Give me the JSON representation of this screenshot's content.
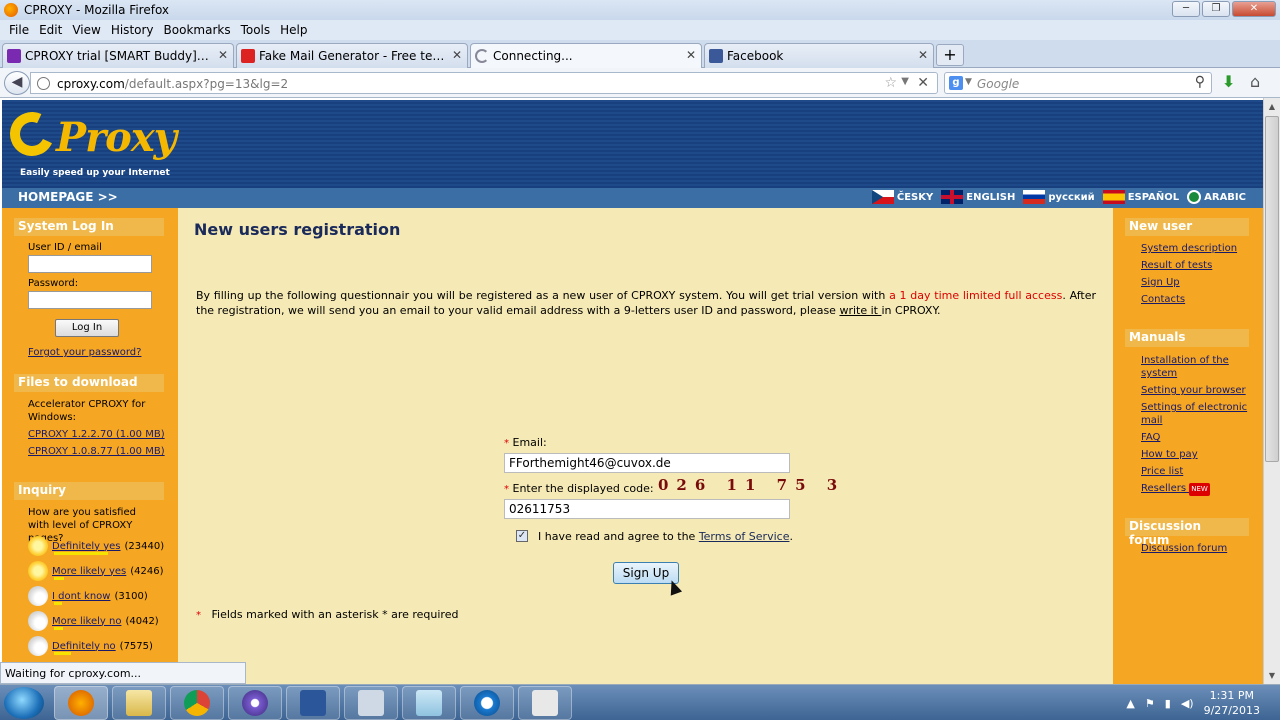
{
  "window": {
    "title": "CPROXY - Mozilla Firefox"
  },
  "menu": [
    "File",
    "Edit",
    "View",
    "History",
    "Bookmarks",
    "Tools",
    "Help"
  ],
  "tabs": [
    {
      "label": "CPROXY trial [SMART Buddy] with D...",
      "icon": "cproxy-icon"
    },
    {
      "label": "Fake Mail Generator - Free temporary...",
      "icon": "fakemail-icon"
    },
    {
      "label": "Connecting...",
      "icon": "loading-icon"
    },
    {
      "label": "Facebook",
      "icon": "facebook-icon"
    }
  ],
  "nav": {
    "url_host": "cproxy.com",
    "url_path": "/default.aspx?pg=13&lg=2",
    "search_placeholder": "Google"
  },
  "header": {
    "logo": "Proxy",
    "tagline": "Easily speed up your Internet",
    "homepage": "HOMEPAGE >>",
    "langs": [
      "ČESKY",
      "ENGLISH",
      "русский",
      "ESPAÑOL",
      "ARABIC"
    ]
  },
  "left": {
    "login_head": "System Log In",
    "user_label": "User ID / email",
    "pass_label": "Password:",
    "login_btn": "Log In",
    "forgot": "Forgot your password?",
    "files_head": "Files to download",
    "files_text": "Accelerator CPROXY for Windows:",
    "file1": "CPROXY 1.2.2.70 (1.00 MB)",
    "file2": "CPROXY 1.0.8.77 (1.00 MB)",
    "inquiry_head": "Inquiry",
    "inquiry_text": "How are you satisfied with level of CPROXY pages?",
    "votes": [
      {
        "label": "Definitely yes",
        "count": "(23440)",
        "share": 1.0
      },
      {
        "label": "More likely yes",
        "count": "(4246)",
        "share": 0.18
      },
      {
        "label": "I dont know",
        "count": "(3100)",
        "share": 0.13
      },
      {
        "label": "More likely no",
        "count": "(4042)",
        "share": 0.17
      },
      {
        "label": "Definitely no",
        "count": "(7575)",
        "share": 0.32
      }
    ]
  },
  "main": {
    "title": "New users registration",
    "para1": "By filling up the following questionnair you will be registered as a new user of CPROXY system. You will get trial version with ",
    "para_red": "a 1 day time limited full access",
    "para2": ". After the registration, we will send you an email to your valid email address with a 9-letters user ID and password, please ",
    "para_link": "write it ",
    "para3": "in CPROXY.",
    "email_label": "Email:",
    "email_value": "FForthemight46@cuvox.de",
    "code_label": "Enter the displayed code:",
    "captcha": "026 11 75 3",
    "code_value": "02611753",
    "agree_text": "I have read and agree to the ",
    "tos": "Terms of Service",
    "agree_end": ".",
    "signup": "Sign Up",
    "required_note": "Fields marked with an asterisk * are required"
  },
  "right": {
    "newuser_head": "New user",
    "newuser_links": [
      "System description",
      "Result of tests",
      "Sign Up",
      "Contacts"
    ],
    "manuals_head": "Manuals",
    "manual_links": [
      "Installation of the system",
      "Setting your browser",
      "Settings of electronic mail",
      "FAQ",
      "How to pay",
      "Price list",
      "Resellers"
    ],
    "new_badge": "NEW",
    "forum_head": "Discussion forum",
    "forum_link": "Discussion forum"
  },
  "status": "Waiting for cproxy.com...",
  "clock": {
    "time": "1:31 PM",
    "date": "9/27/2013"
  }
}
